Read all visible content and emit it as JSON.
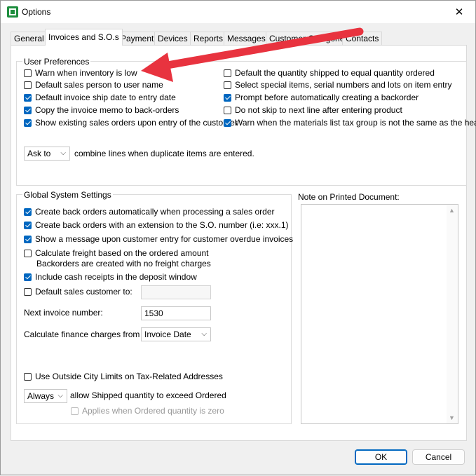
{
  "window": {
    "title": "Options",
    "close_glyph": "✕"
  },
  "tabs": [
    {
      "label": "General"
    },
    {
      "label": "Invoices and S.O.s"
    },
    {
      "label": "Payment"
    },
    {
      "label": "Devices"
    },
    {
      "label": "Reports"
    },
    {
      "label": "Messages"
    },
    {
      "label": "Customer Categories"
    },
    {
      "label": "Contacts"
    }
  ],
  "user_prefs": {
    "title": "User Preferences",
    "left": [
      {
        "label": "Warn when inventory is low",
        "checked": false
      },
      {
        "label": "Default sales person to user name",
        "checked": false
      },
      {
        "label": "Default invoice ship date to entry date",
        "checked": true
      },
      {
        "label": "Copy the invoice memo to back-orders",
        "checked": true
      },
      {
        "label": "Show existing sales orders upon entry of the customer",
        "checked": true
      }
    ],
    "right": [
      {
        "label": "Default the quantity shipped to equal quantity ordered",
        "checked": false
      },
      {
        "label": "Select special items, serial numbers and lots on item entry",
        "checked": false
      },
      {
        "label": "Prompt before automatically creating a backorder",
        "checked": true
      },
      {
        "label": "Do not skip to next line after entering product",
        "checked": false
      },
      {
        "label": "Warn when the materials list tax group is not the same as the header",
        "checked": true
      }
    ],
    "combine_select": "Ask to",
    "combine_label": "combine lines when duplicate items are entered."
  },
  "global": {
    "title": "Global System Settings",
    "checks": [
      {
        "label": "Create back orders automatically when processing a sales order",
        "checked": true
      },
      {
        "label": "Create back orders with an extension to the S.O. number (i.e: xxx.1)",
        "checked": true
      },
      {
        "label": "Show a message upon customer entry for customer overdue invoices",
        "checked": true
      },
      {
        "label": "Calculate freight based on the ordered amount",
        "checked": false
      },
      {
        "label": "Include cash receipts in the deposit window",
        "checked": true
      },
      {
        "label": "Default sales customer to:",
        "checked": false
      }
    ],
    "freight_note": "Backorders are created with no freight charges",
    "default_customer_value": "",
    "next_invoice_label": "Next invoice number:",
    "next_invoice_value": "1530",
    "finance_label": "Calculate finance charges from the",
    "finance_value": "Invoice Date",
    "outside_city": {
      "label": "Use Outside City Limits on Tax-Related Addresses",
      "checked": false
    },
    "shipped_select": "Always",
    "shipped_label": "allow Shipped quantity to exceed Ordered",
    "applies_zero": {
      "label": "Applies when Ordered quantity is zero",
      "checked": false
    }
  },
  "note": {
    "label": "Note on Printed Document:",
    "value": ""
  },
  "buttons": {
    "ok": "OK",
    "cancel": "Cancel"
  },
  "colors": {
    "accent": "#0067c0",
    "arrow": "#e8333f"
  }
}
